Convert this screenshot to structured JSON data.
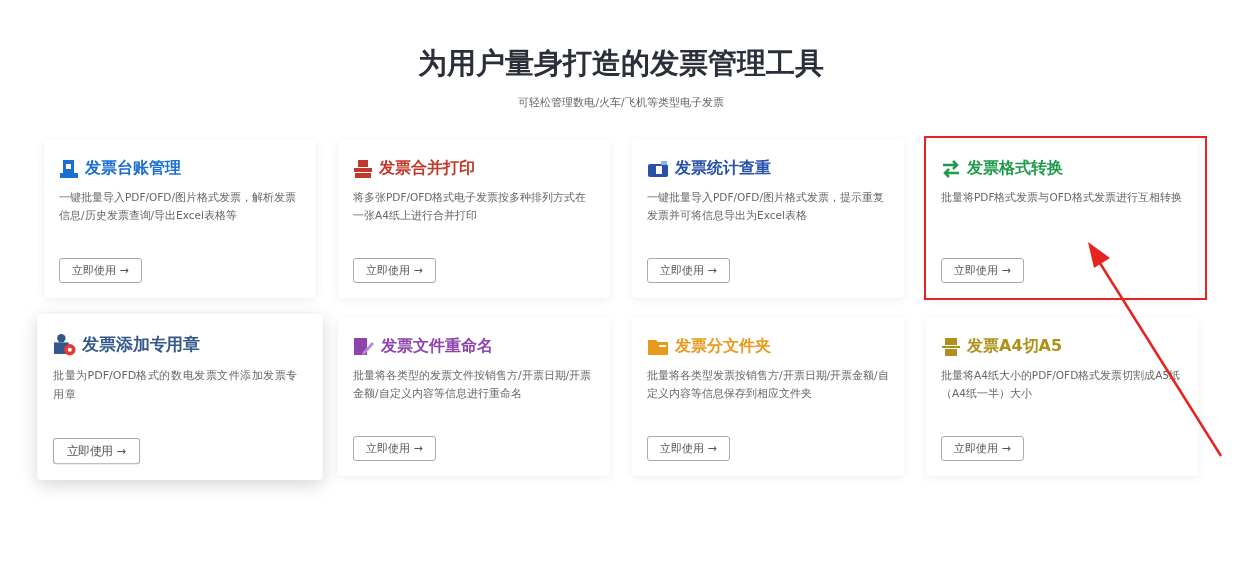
{
  "heading": "为用户量身打造的发票管理工具",
  "subheading": "可轻松管理数电/火车/飞机等类型电子发票",
  "cards": [
    {
      "title": "发票台账管理",
      "color": "#1a6fd0",
      "description": "一键批量导入PDF/OFD/图片格式发票，解析发票信息/历史发票查询/导出Excel表格等",
      "button": "立即使用 →",
      "highlighted": false,
      "hovered": false
    },
    {
      "title": "发票合并打印",
      "color": "#c0392b",
      "description": "将多张PDF/OFD格式电子发票按多种排列方式在一张A4纸上进行合并打印",
      "button": "立即使用 →",
      "highlighted": false,
      "hovered": false
    },
    {
      "title": "发票统计查重",
      "color": "#2850a8",
      "description": "一键批量导入PDF/OFD/图片格式发票，提示重复发票并可将信息导出为Excel表格",
      "button": "立即使用 →",
      "highlighted": false,
      "hovered": false
    },
    {
      "title": "发票格式转换",
      "color": "#1f9a4a",
      "description": "批量将PDF格式发票与OFD格式发票进行互相转换",
      "button": "立即使用 →",
      "highlighted": true,
      "hovered": false
    },
    {
      "title": "发票添加专用章",
      "color": "#34568b",
      "description": "批量为PDF/OFD格式的数电发票文件添加发票专用章",
      "button": "立即使用 →",
      "highlighted": false,
      "hovered": true
    },
    {
      "title": "发票文件重命名",
      "color": "#8e44ad",
      "description": "批量将各类型的发票文件按销售方/开票日期/开票金额/自定义内容等信息进行重命名",
      "button": "立即使用 →",
      "highlighted": false,
      "hovered": false
    },
    {
      "title": "发票分文件夹",
      "color": "#e89a1c",
      "description": "批量将各类型发票按销售方/开票日期/开票金额/自定义内容等信息保存到相应文件夹",
      "button": "立即使用 →",
      "highlighted": false,
      "hovered": false
    },
    {
      "title": "发票A4切A5",
      "color": "#b0901a",
      "description": "批量将A4纸大小的PDF/OFD格式发票切割成A5纸（A4纸一半）大小",
      "button": "立即使用 →",
      "highlighted": false,
      "hovered": false
    }
  ]
}
